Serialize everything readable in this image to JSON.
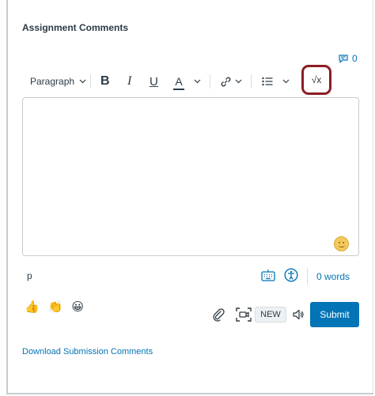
{
  "section": {
    "title": "Assignment Comments"
  },
  "comments": {
    "count": "0",
    "icon": "comment-icon"
  },
  "toolbar": {
    "block_format": "Paragraph",
    "bold_label": "B",
    "italic_label": "I",
    "underline_label": "U",
    "text_color_label": "A",
    "math_label": "√x",
    "icons": [
      "chevron-down-icon",
      "link-icon",
      "bullet-list-icon",
      "equation-icon"
    ],
    "highlight_color": "#8c1d24"
  },
  "editor": {
    "value": "",
    "emoji_icon": "emoji-picker-icon"
  },
  "status": {
    "path": "p",
    "word_count": "0 words",
    "icons": [
      "keyboard-shortcuts-icon",
      "accessibility-checker-icon"
    ]
  },
  "quick_emojis": [
    "👍",
    "👏",
    "😀"
  ],
  "actions": {
    "new_label": "NEW",
    "submit_label": "Submit",
    "icons": [
      "attachment-icon",
      "media-capture-icon",
      "speaker-icon"
    ]
  },
  "links": {
    "download": "Download Submission Comments"
  },
  "colors": {
    "link": "#0374b5",
    "primary_button": "#0374b5",
    "text": "#2d3b45"
  }
}
